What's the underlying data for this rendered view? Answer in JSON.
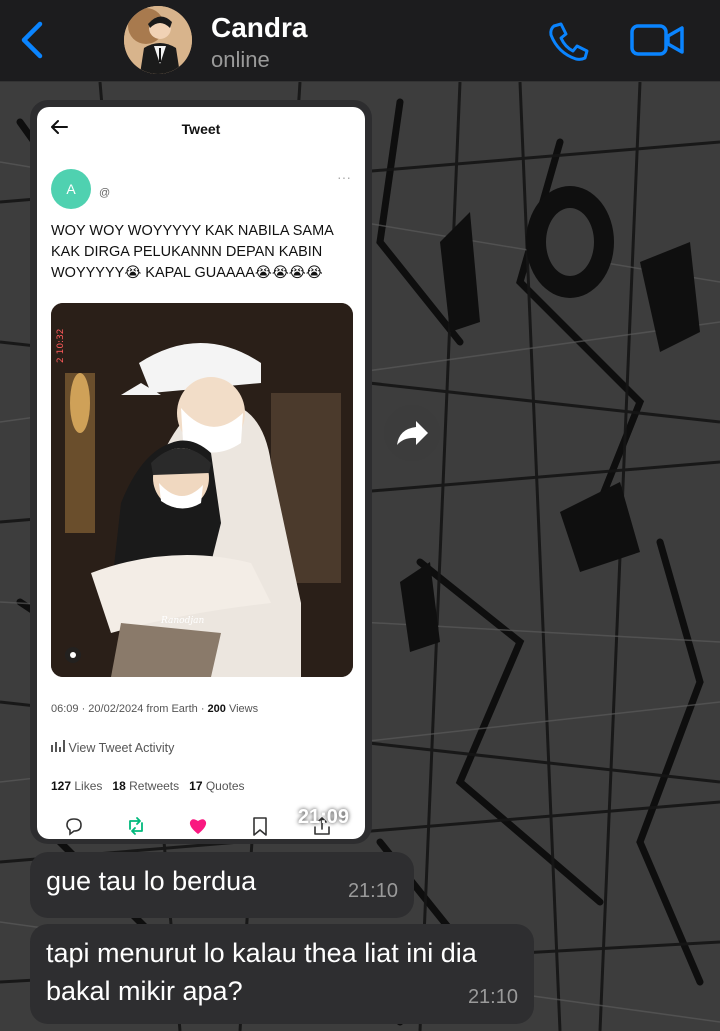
{
  "header": {
    "contact_name": "Candra",
    "status": "online"
  },
  "shared_tweet": {
    "screen_title": "Tweet",
    "author_initial": "A",
    "author_handle": "@",
    "text": "WOY WOY WOYYYYY KAK NABILA SAMA KAK DIRGA PELUKANNN DEPAN KABIN WOYYYYY😭 KAPAL GUAAAA😭😭😭😭",
    "photo_watermark": "Ranodjan",
    "photo_overlay_text": "2 10:32",
    "meta_time": "06:09 · 20/02/2024 from Earth · ",
    "meta_views_count": "200",
    "meta_views_label": " Views",
    "activity_label": "View Tweet Activity",
    "stats": {
      "likes_count": "127",
      "likes_label": " Likes",
      "retweets_count": "18",
      "retweets_label": " Retweets",
      "quotes_count": "17",
      "quotes_label": " Quotes"
    },
    "sent_time": "21:09"
  },
  "messages": [
    {
      "text": "gue tau lo berdua",
      "time": "21:10"
    },
    {
      "text": "tapi menurut lo kalau thea liat ini dia bakal mikir apa?",
      "time": "21:10"
    }
  ],
  "colors": {
    "accent": "#0a84ff",
    "bubble": "#2e2e30",
    "tweet_avatar": "#4fd1b0",
    "like": "#f91880",
    "retweet": "#00ba7c"
  }
}
